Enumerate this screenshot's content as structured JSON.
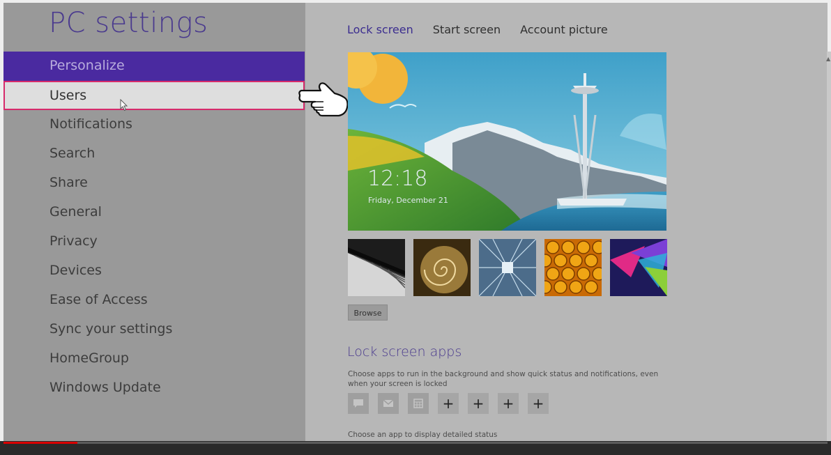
{
  "app": {
    "title": "PC settings"
  },
  "sidebar": {
    "items": [
      {
        "label": "Personalize",
        "state": "selected"
      },
      {
        "label": "Users",
        "state": "hovered"
      },
      {
        "label": "Notifications",
        "state": "normal"
      },
      {
        "label": "Search",
        "state": "normal"
      },
      {
        "label": "Share",
        "state": "normal"
      },
      {
        "label": "General",
        "state": "normal"
      },
      {
        "label": "Privacy",
        "state": "normal"
      },
      {
        "label": "Devices",
        "state": "normal"
      },
      {
        "label": "Ease of Access",
        "state": "normal"
      },
      {
        "label": "Sync your settings",
        "state": "normal"
      },
      {
        "label": "HomeGroup",
        "state": "normal"
      },
      {
        "label": "Windows Update",
        "state": "normal"
      }
    ]
  },
  "tabs": [
    {
      "label": "Lock screen",
      "active": true
    },
    {
      "label": "Start screen",
      "active": false
    },
    {
      "label": "Account picture",
      "active": false
    }
  ],
  "lock_preview": {
    "time": "12:18",
    "date": "Friday, December 21"
  },
  "thumbnails": [
    "piano-keys",
    "nautilus-shell",
    "tunnel-lines",
    "honeycomb",
    "colored-triangles"
  ],
  "browse_label": "Browse",
  "lock_screen_apps": {
    "heading": "Lock screen apps",
    "description": "Choose apps to run in the background and show quick status and notifications, even when your screen is locked",
    "slots": [
      {
        "icon": "message-icon",
        "text": ""
      },
      {
        "icon": "mail-icon",
        "text": ""
      },
      {
        "icon": "calendar-icon",
        "text": ""
      },
      {
        "icon": "plus-icon",
        "text": "+"
      },
      {
        "icon": "plus-icon",
        "text": "+"
      },
      {
        "icon": "plus-icon",
        "text": "+"
      },
      {
        "icon": "plus-icon",
        "text": "+"
      }
    ],
    "detail_label": "Choose an app to display detailed status"
  },
  "video_progress": 0.09,
  "colors": {
    "accent": "#4a2aa0",
    "title": "#4a3a8e",
    "highlight_border": "#d62a6b",
    "progress": "#d90000"
  }
}
